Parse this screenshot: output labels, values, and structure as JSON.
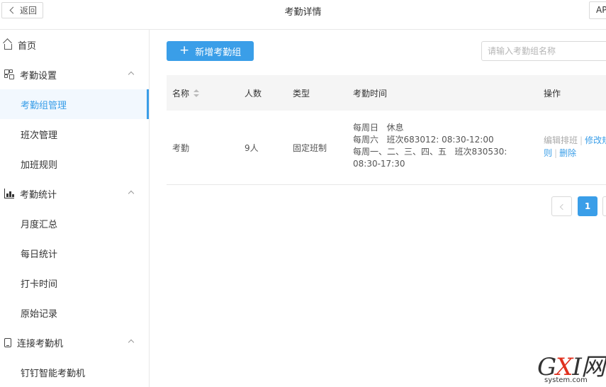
{
  "topbar": {
    "back_label": "返回",
    "title": "考勤详情",
    "right_button_label": "AP"
  },
  "sidebar": {
    "items": [
      {
        "label": "首页",
        "level": "top",
        "icon": "home-icon"
      },
      {
        "label": "考勤设置",
        "level": "top",
        "icon": "grid-icon",
        "expanded": true
      },
      {
        "label": "考勤组管理",
        "level": "sub",
        "active": true
      },
      {
        "label": "班次管理",
        "level": "sub"
      },
      {
        "label": "加班规则",
        "level": "sub"
      },
      {
        "label": "考勤统计",
        "level": "top",
        "icon": "bar-chart-icon",
        "expanded": true
      },
      {
        "label": "月度汇总",
        "level": "sub"
      },
      {
        "label": "每日统计",
        "level": "sub"
      },
      {
        "label": "打卡时间",
        "level": "sub"
      },
      {
        "label": "原始记录",
        "level": "sub"
      },
      {
        "label": "连接考勤机",
        "level": "top",
        "icon": "device-icon",
        "expanded": true
      },
      {
        "label": "钉钉智能考勤机",
        "level": "sub"
      }
    ]
  },
  "main": {
    "add_button_label": "新增考勤组",
    "search": {
      "placeholder": "请输入考勤组名称",
      "value": ""
    },
    "table": {
      "headers": {
        "name": "名称",
        "count": "人数",
        "type": "类型",
        "time": "考勤时间",
        "ops": "操作"
      },
      "rows": [
        {
          "name": "考勤",
          "count": "9人",
          "type": "固定班制",
          "time_lines": [
            "每周日   休息",
            "每周六   班次683012: 08:30-12:00",
            "每周一、二、三、四、五   班次830530: 08:30-17:30"
          ],
          "ops": {
            "edit_schedule": "编辑排班",
            "modify_rule": "修改规则",
            "delete": "删除"
          }
        }
      ]
    },
    "pagination": {
      "current_page": "1"
    }
  },
  "watermark": {
    "brand": "GXI网",
    "domain": "system.com"
  },
  "colors": {
    "accent": "#3a9ee8",
    "border": "#e8e8e8",
    "header_bg": "#f5f5f5"
  }
}
